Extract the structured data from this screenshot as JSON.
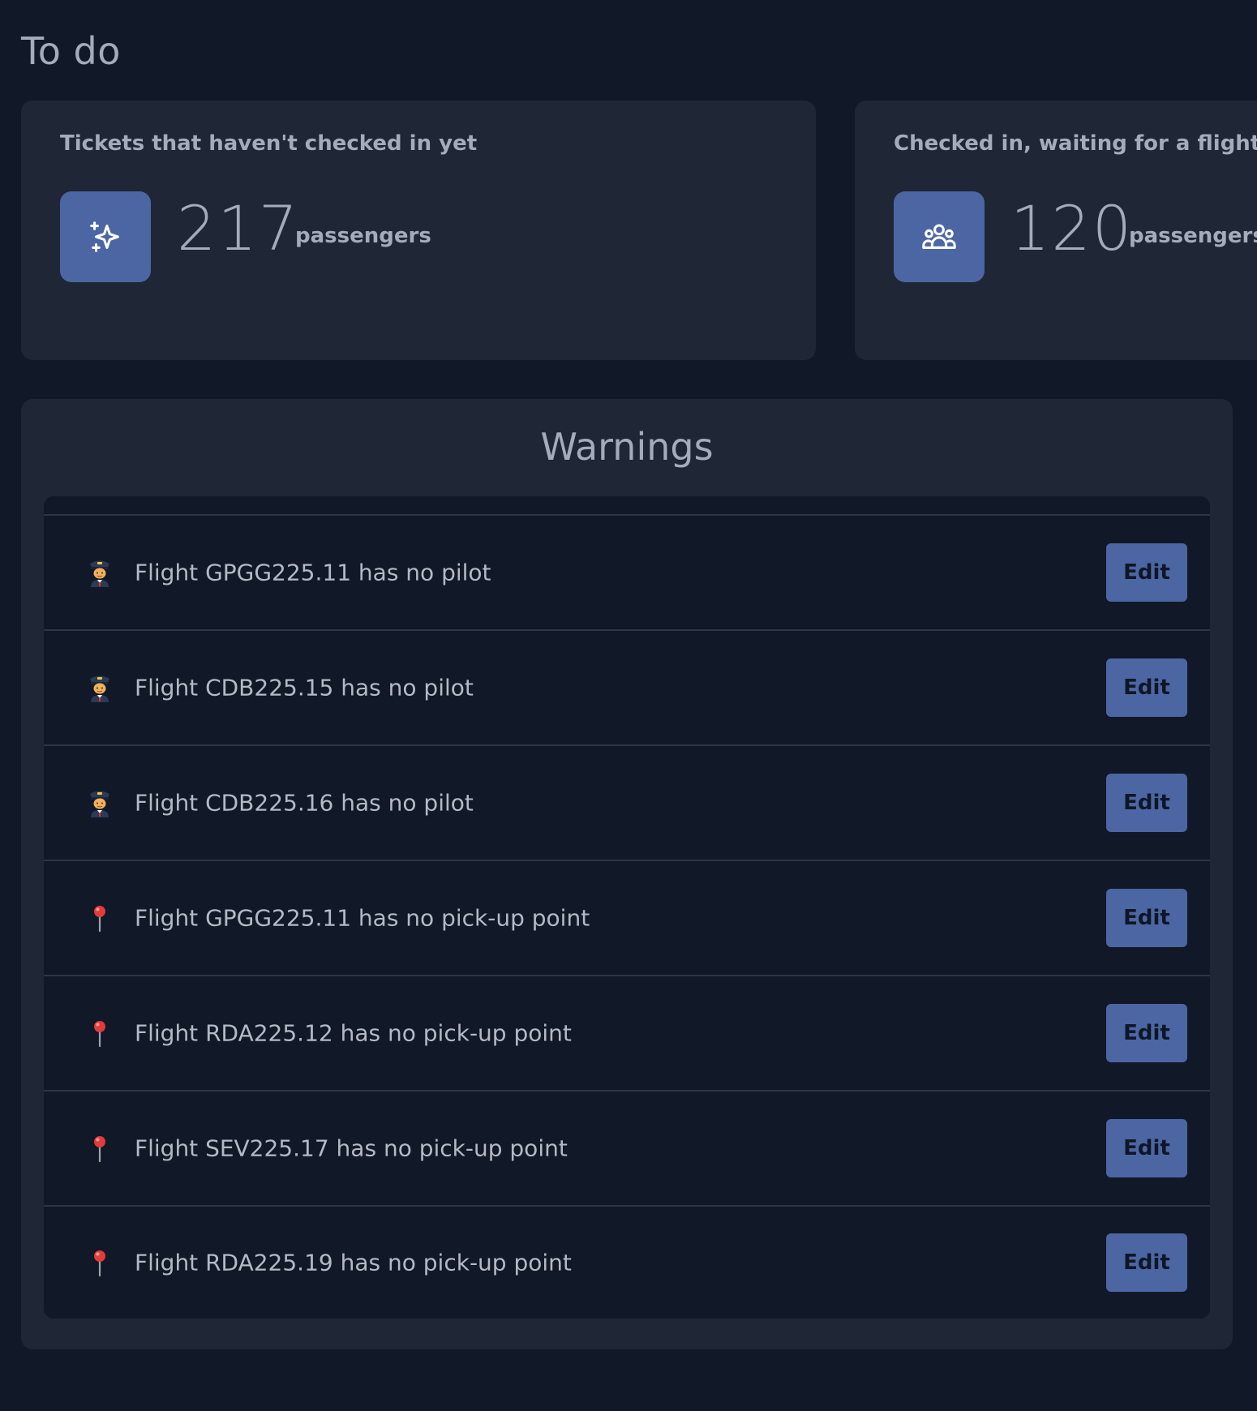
{
  "page": {
    "title": "To do"
  },
  "cards": [
    {
      "title": "Tickets that haven't checked in yet",
      "value": "217",
      "unit": "passengers",
      "icon": "sparkles-icon"
    },
    {
      "title": "Checked in, waiting for a flight proposal",
      "value": "120",
      "unit": "passengers",
      "icon": "user-group-icon"
    }
  ],
  "warnings": {
    "title": "Warnings",
    "edit_label": "Edit",
    "items": [
      {
        "icon": "pilot-icon",
        "text": "Flight GPGG225.11 has no pilot"
      },
      {
        "icon": "pilot-icon",
        "text": "Flight CDB225.15 has no pilot"
      },
      {
        "icon": "pilot-icon",
        "text": "Flight CDB225.16 has no pilot"
      },
      {
        "icon": "pin-icon",
        "text": "Flight GPGG225.11 has no pick-up point"
      },
      {
        "icon": "pin-icon",
        "text": "Flight RDA225.12 has no pick-up point"
      },
      {
        "icon": "pin-icon",
        "text": "Flight SEV225.17 has no pick-up point"
      },
      {
        "icon": "pin-icon",
        "text": "Flight RDA225.19 has no pick-up point"
      }
    ]
  },
  "colors": {
    "background": "#111827",
    "card": "#1f2635",
    "accent": "#4b66a3",
    "text": "#a3acbb"
  }
}
